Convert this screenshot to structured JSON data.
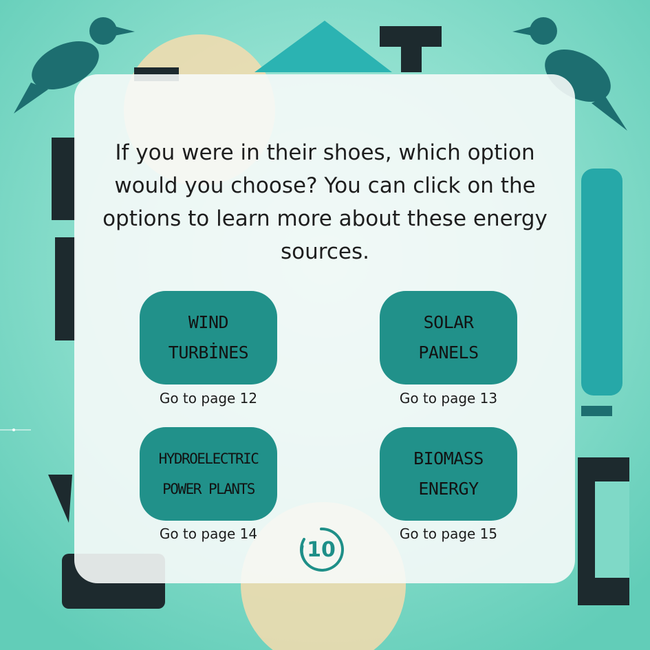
{
  "question": "If you were in their shoes, which option would you choose? You can click on the options to learn more about these energy sources.",
  "options": [
    {
      "label": "WIND\nTURBİNES",
      "link": "Go to page 12"
    },
    {
      "label": "SOLAR\nPANELS",
      "link": "Go to page 13"
    },
    {
      "label": "HYDROELECTRIC\nPOWER PLANTS",
      "link": "Go to page 14"
    },
    {
      "label": "BIOMASS\nENERGY",
      "link": "Go to page 15"
    }
  ],
  "page_number": "10",
  "colors": {
    "background": "#7fd9c7",
    "option_fill": "#21918a",
    "badge": "#1e8f88"
  }
}
